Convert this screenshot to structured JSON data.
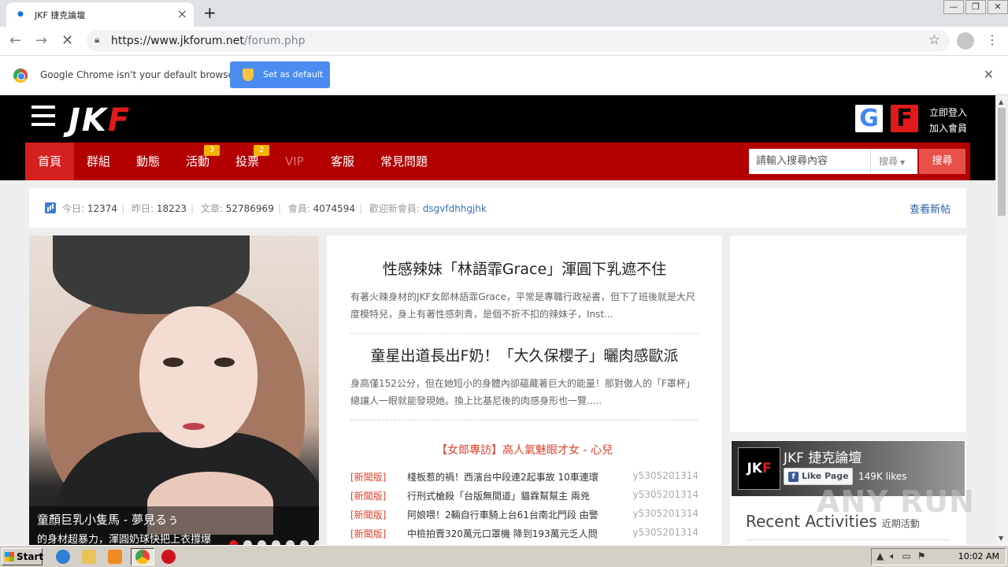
{
  "browser": {
    "tab_title": "JKF 捷克論壇",
    "url_host": "https://www.jkforum.net",
    "url_path": "/forum.php",
    "infobar_message": "Google Chrome isn't your default browser",
    "set_default_label": "Set as default"
  },
  "site": {
    "logo": {
      "main": "JK",
      "accent": "F"
    },
    "google_letter": "G",
    "facebook_letter": "F",
    "login": "立即登入",
    "register": "加入會員",
    "nav": [
      {
        "label": "首頁",
        "active": true
      },
      {
        "label": "群組"
      },
      {
        "label": "動態"
      },
      {
        "label": "活動",
        "badge": "3"
      },
      {
        "label": "投票",
        "badge": "2"
      },
      {
        "label": "VIP"
      },
      {
        "label": "客服"
      },
      {
        "label": "常見問題"
      }
    ],
    "search": {
      "placeholder": "請輸入搜尋內容",
      "select": "搜尋",
      "button": "搜尋"
    },
    "stats": {
      "today_label": "今日:",
      "today": "12374",
      "yesterday_label": "昨日:",
      "yesterday": "18223",
      "posts_label": "文章:",
      "posts": "52786969",
      "members_label": "會員:",
      "members": "4074594",
      "welcome_label": "歡迎新會員:",
      "new_member": "dsgvfdhhgjhk",
      "view_new": "查看新帖"
    },
    "hero": {
      "title": "童顏巨乳小隻馬 - 夢見るぅ",
      "subtitle": "的身材超暴力，渾圓奶球快把上衣撐爆"
    },
    "articles": [
      {
        "title": "性感辣妹「林語霏Grace」渾圓下乳遮不住",
        "body": "有著火辣身材的JKF女郎林語霏Grace，平常是專職行政祕書，但下了班後就是大尺度模特兒，身上有著性感刺青，是個不折不扣的辣妹子，Inst..."
      },
      {
        "title": "童星出道長出F奶！「大久保櫻子」曬肉感歐派",
        "body": "身高僅152公分，但在她短小的身體內卻蘊藏著巨大的能量！那對傲人的「F罩杯」總讓人一眼就能發現她。換上比基尼後的肉感身形也一覽....."
      }
    ],
    "feature_link": "【女郎專訪】高人氣魅眼才女 - 心兒",
    "news": [
      {
        "cat": "[新聞版]",
        "title": "棧板惹的禍！西濱台中段連2起事故 10車連環",
        "author": "y5305201314"
      },
      {
        "cat": "[新聞版]",
        "title": "行刑式槍殺「台版無間道」貓霖幫幫主 兩兇",
        "author": "y5305201314"
      },
      {
        "cat": "[新聞版]",
        "title": "阿娘喂！2輛自行車騎上台61台南北門段 由警",
        "author": "y5305201314"
      },
      {
        "cat": "[新聞版]",
        "title": "中檢拍賣320萬元口罩機 降到193萬元乏人問",
        "author": "y5305201314"
      }
    ],
    "facebook": {
      "logo_main": "JK",
      "logo_accent": "F",
      "page_name_main": "JKF",
      "page_name_rest": " 捷克論壇",
      "like_label": "Like Page",
      "likes": "149K likes"
    },
    "recent_title": "Recent Activities",
    "recent_subtitle": "近期活動"
  },
  "watermark": "ANY RUN",
  "taskbar": {
    "start": "Start",
    "clock": "10:02 AM"
  }
}
